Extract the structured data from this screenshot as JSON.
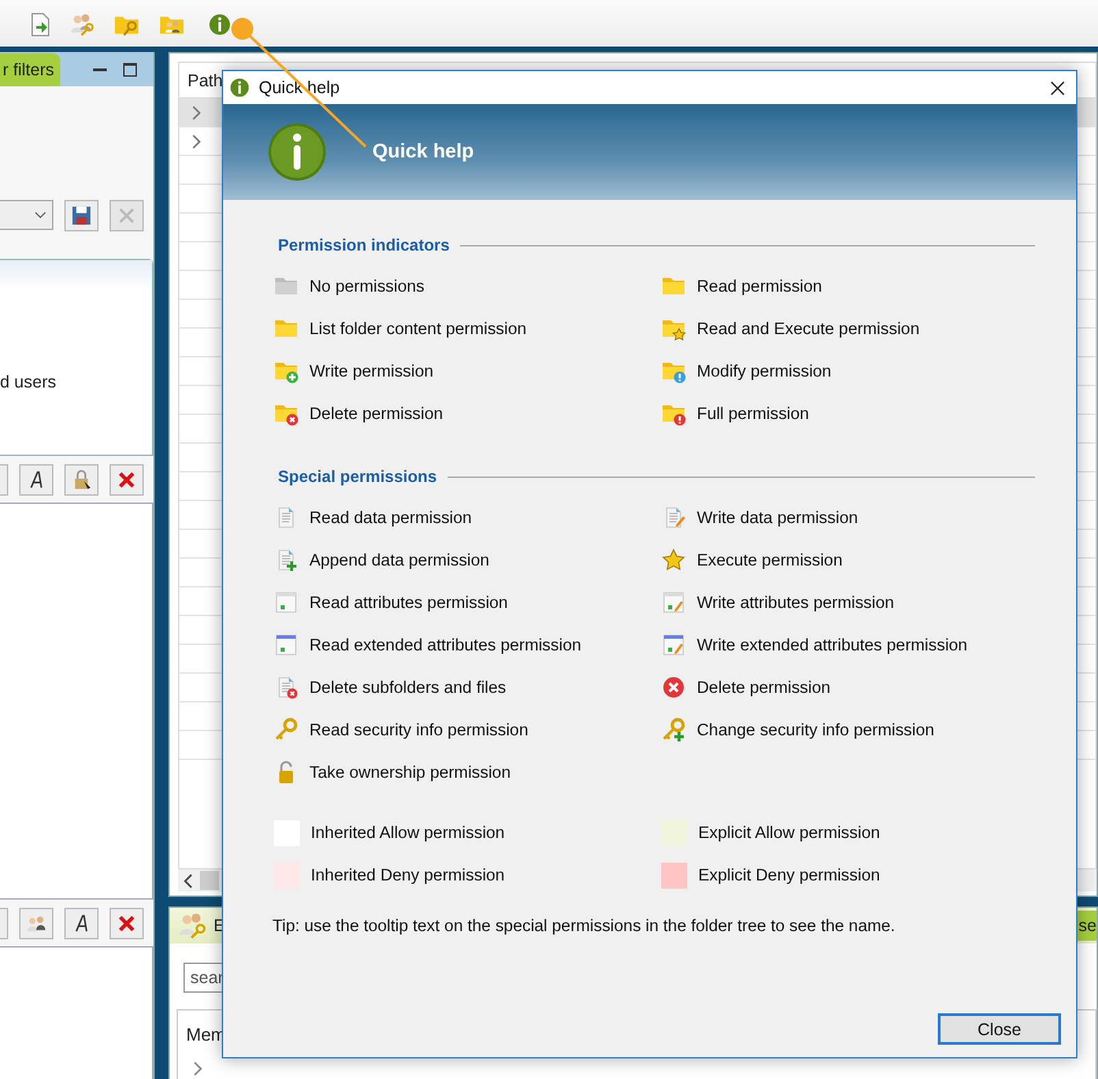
{
  "left_panel": {
    "tab": "r filters",
    "list_text": "d users"
  },
  "path_table": {
    "header": "Path",
    "rows": [
      {
        "expandable": true,
        "selected": true
      },
      {
        "expandable": true,
        "selected": false
      },
      {
        "expandable": false,
        "selected": false
      },
      {
        "expandable": false,
        "selected": false
      },
      {
        "expandable": false,
        "selected": false
      }
    ]
  },
  "bottom_panel": {
    "tab": "E",
    "search_placeholder": "sear",
    "column": "Mem",
    "right_tab": "se"
  },
  "dialog": {
    "title": "Quick help",
    "heading": "Quick help",
    "sections": [
      {
        "title": "Permission indicators",
        "items": [
          {
            "label": "No permissions",
            "kind": "folder-none"
          },
          {
            "label": "Read permission",
            "kind": "folder"
          },
          {
            "label": "List folder content permission",
            "kind": "folder"
          },
          {
            "label": "Read and Execute permission",
            "kind": "folder-star"
          },
          {
            "label": "Write permission",
            "kind": "folder-add"
          },
          {
            "label": "Modify permission",
            "kind": "folder-info"
          },
          {
            "label": "Delete permission",
            "kind": "folder-delete"
          },
          {
            "label": "Full permission",
            "kind": "folder-alert"
          }
        ]
      },
      {
        "title": "Special permissions",
        "items": [
          {
            "label": "Read data permission",
            "kind": "doc"
          },
          {
            "label": "Write data permission",
            "kind": "doc-edit"
          },
          {
            "label": "Append data permission",
            "kind": "doc-add"
          },
          {
            "label": "Execute permission",
            "kind": "star"
          },
          {
            "label": "Read attributes permission",
            "kind": "attr"
          },
          {
            "label": "Write attributes permission",
            "kind": "attr-edit"
          },
          {
            "label": "Read extended attributes permission",
            "kind": "ext-attr"
          },
          {
            "label": "Write extended attributes permission",
            "kind": "ext-attr-edit"
          },
          {
            "label": "Delete subfolders and files",
            "kind": "doc-delete"
          },
          {
            "label": "Delete permission",
            "kind": "delete"
          },
          {
            "label": "Read security info permission",
            "kind": "key"
          },
          {
            "label": "Change security info permission",
            "kind": "key-add"
          },
          {
            "label": "Take ownership permission",
            "kind": "lock"
          }
        ]
      }
    ],
    "legend": [
      {
        "label": "Inherited Allow permission",
        "color": "#ffffff"
      },
      {
        "label": "Explicit Allow permission",
        "color": "#f0f5dc"
      },
      {
        "label": "Inherited Deny permission",
        "color": "#ffe8e8"
      },
      {
        "label": "Explicit Deny permission",
        "color": "#ffc4c4"
      }
    ],
    "tip": "Tip: use the tooltip text on the special permissions in the folder tree to see the name.",
    "button": "Close"
  }
}
